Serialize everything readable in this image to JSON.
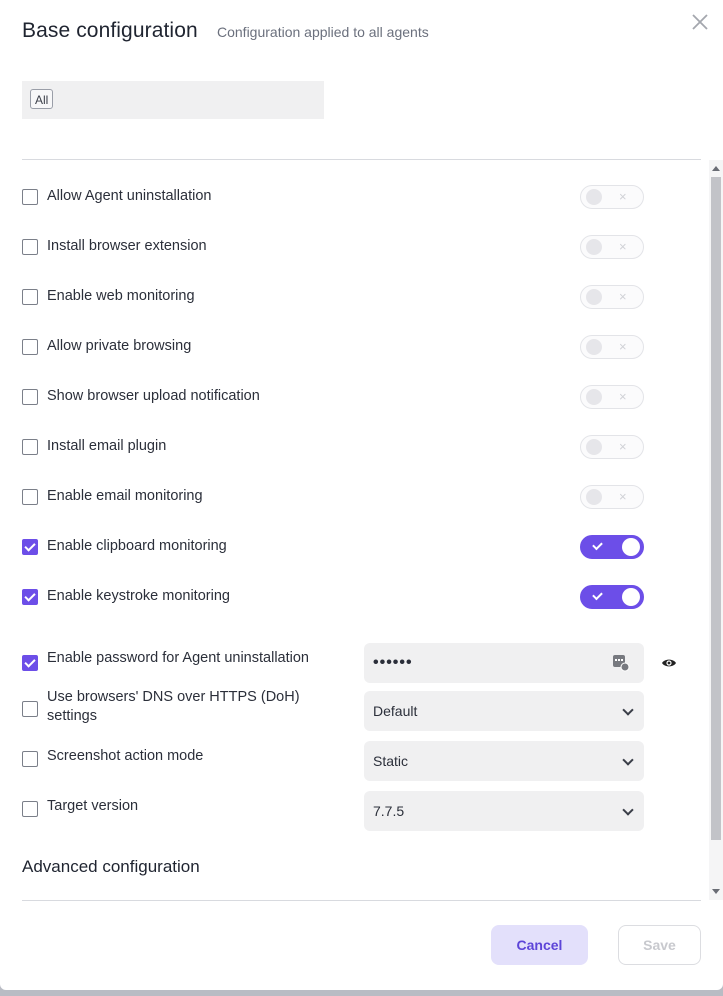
{
  "header": {
    "title": "Base configuration",
    "subtitle": "Configuration applied to all agents",
    "close_icon": "close-icon"
  },
  "scope": {
    "chip_label": "All"
  },
  "settings": [
    {
      "label": "Allow Agent uninstallation",
      "checked": false,
      "toggle_on": false
    },
    {
      "label": "Install browser extension",
      "checked": false,
      "toggle_on": false
    },
    {
      "label": "Enable web monitoring",
      "checked": false,
      "toggle_on": false
    },
    {
      "label": "Allow private browsing",
      "checked": false,
      "toggle_on": false
    },
    {
      "label": "Show browser upload notification",
      "checked": false,
      "toggle_on": false
    },
    {
      "label": "Install email plugin",
      "checked": false,
      "toggle_on": false
    },
    {
      "label": "Enable email monitoring",
      "checked": false,
      "toggle_on": false
    },
    {
      "label": "Enable clipboard monitoring",
      "checked": true,
      "toggle_on": true
    },
    {
      "label": "Enable keystroke monitoring",
      "checked": true,
      "toggle_on": true
    }
  ],
  "password_setting": {
    "label": "Enable password for Agent uninstallation",
    "checked": true,
    "value": "••••••"
  },
  "doh_setting": {
    "label_line1": "Use browsers' DNS over HTTPS (DoH)",
    "label_line2": "settings",
    "checked": false,
    "selected": "Default"
  },
  "screenshot_setting": {
    "label": "Screenshot action mode",
    "checked": false,
    "selected": "Static"
  },
  "version_setting": {
    "label": "Target version",
    "checked": false,
    "selected": "7.7.5"
  },
  "advanced": {
    "title": "Advanced configuration"
  },
  "footer": {
    "cancel_label": "Cancel",
    "save_label": "Save"
  },
  "colors": {
    "accent": "#6c4ee8",
    "cancel_bg": "#e3e0fb",
    "field_bg": "#f0f0f1"
  }
}
